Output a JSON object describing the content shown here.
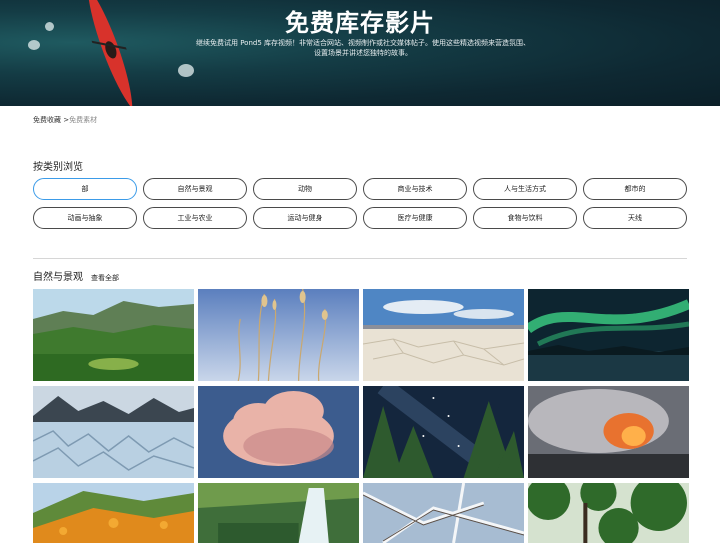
{
  "hero": {
    "title": "免费库存影片",
    "description": "继续免费试用 Pond5 库存视频！非常适合网站、视频制作或社交媒体帖子。使用这些精选视频来营造氛围、设置场景并讲述您独特的故事。"
  },
  "breadcrumb": {
    "root": "免费收藏",
    "separator": " >",
    "current": "免费素材"
  },
  "browse": {
    "title": "按类别浏览",
    "categories": [
      {
        "label": "部",
        "active": true
      },
      {
        "label": "自然与景观"
      },
      {
        "label": "动物"
      },
      {
        "label": "商业与技术"
      },
      {
        "label": "人与生活方式"
      },
      {
        "label": "都市的"
      },
      {
        "label": "动画与抽象"
      },
      {
        "label": "工业与农业"
      },
      {
        "label": "运动与健身"
      },
      {
        "label": "医疗与健康"
      },
      {
        "label": "食物与饮料"
      },
      {
        "label": "天线"
      }
    ]
  },
  "section": {
    "title": "自然与景观",
    "view_all": "查看全部"
  },
  "thumbnails": [
    {
      "name": "green-mountain-valley"
    },
    {
      "name": "grass-stems-sky"
    },
    {
      "name": "salt-flats"
    },
    {
      "name": "aurora-lake"
    },
    {
      "name": "glacier-mountains"
    },
    {
      "name": "pink-cloud"
    },
    {
      "name": "starry-forest"
    },
    {
      "name": "lava-steam-ocean"
    },
    {
      "name": "orange-wildflowers"
    },
    {
      "name": "waterfall-green"
    },
    {
      "name": "snowy-branches"
    },
    {
      "name": "forest-canopy"
    }
  ]
}
